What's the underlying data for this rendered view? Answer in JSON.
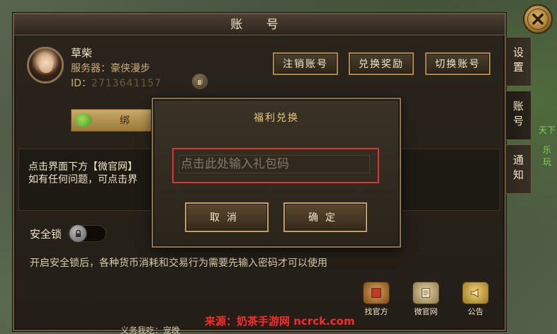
{
  "panel": {
    "title": "账 号"
  },
  "side_tabs": [
    {
      "label": "设置"
    },
    {
      "label": "账号"
    },
    {
      "label": "通知"
    }
  ],
  "player": {
    "name": "草柴",
    "server_label": "服务器：",
    "server_value": "豪侠漫步",
    "id_label": "ID：",
    "id_value": "2713641157"
  },
  "account_buttons": {
    "logout": "注销账号",
    "redeem": "兑换奖励",
    "switch": "切换账号"
  },
  "bind": {
    "label": "绑"
  },
  "info": {
    "line1": "点击界面下方【微官网】",
    "line2": "如有任何问题，可点击界"
  },
  "security": {
    "label": "安全锁",
    "description": "开启安全锁后，各种货币消耗和交易行为需要先输入密码才可以使用",
    "enabled": false
  },
  "shortcuts": [
    {
      "label": "找官方",
      "icon": "official-seal-icon"
    },
    {
      "label": "微官网",
      "icon": "scroll-icon"
    },
    {
      "label": "公告",
      "icon": "horn-icon"
    }
  ],
  "footer": {
    "partial_text": "义务我吃：宠晚",
    "watermark": "来源：奶茶手游网 ncrck.com"
  },
  "world": {
    "side_text": "天下",
    "side_text2": "乐玩"
  },
  "modal": {
    "title": "福利兑换",
    "input_placeholder": "点击此处输入礼包码",
    "cancel_label": "取消",
    "confirm_label": "确定"
  },
  "colors": {
    "accent_gold": "#c2a064",
    "highlight_red": "#e03434",
    "text_cream": "#f1e6cc"
  }
}
